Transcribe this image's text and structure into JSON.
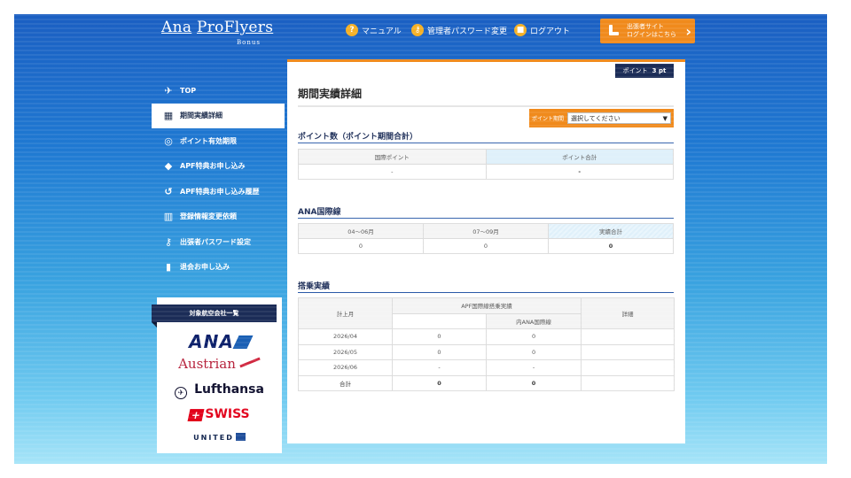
{
  "header": {
    "logo_main_a": "Ana",
    "logo_main_b": "ProFlyers",
    "logo_sub": "Bonus",
    "nav": [
      {
        "icon": "question-circle-icon",
        "glyph": "?",
        "label": "マニュアル"
      },
      {
        "icon": "key-circle-icon",
        "glyph": "⚷",
        "label": "管理者パスワード変更"
      },
      {
        "icon": "lock-circle-icon",
        "glyph": "■",
        "label": "ログアウト"
      }
    ],
    "sub_login": {
      "line1": "出張者サイト",
      "line2": "ログインはこちら",
      "chevron": "›"
    }
  },
  "menu": [
    {
      "icon": "airplane-icon",
      "glyph": "✈",
      "label": "TOP",
      "active": false
    },
    {
      "icon": "calendar-icon",
      "glyph": "▦",
      "label": "期間実績詳細",
      "active": true
    },
    {
      "icon": "coin-icon",
      "glyph": "◎",
      "label": "ポイント有効期限",
      "active": false
    },
    {
      "icon": "gift-icon",
      "glyph": "◆",
      "label": "APF特典お申し込み",
      "active": false
    },
    {
      "icon": "history-icon",
      "glyph": "↺",
      "label": "APF特典お申し込み履歴",
      "active": false
    },
    {
      "icon": "form-icon",
      "glyph": "▥",
      "label": "登録情報変更依頼",
      "active": false
    },
    {
      "icon": "key-person-icon",
      "glyph": "⚷",
      "label": "出張者パスワード設定",
      "active": false
    },
    {
      "icon": "exit-door-icon",
      "glyph": "▮",
      "label": "退会お申し込み",
      "active": false
    }
  ],
  "airlines": {
    "heading": "対象航空会社一覧",
    "list": [
      "ANA",
      "Austrian",
      "Lufthansa",
      "SWISS",
      "UNITED"
    ]
  },
  "main": {
    "points_badge": {
      "label": "ポイント",
      "value": "3 pt"
    },
    "title": "期間実績詳細",
    "filter": {
      "label": "ポイント期間",
      "selected": "選択してください"
    },
    "points_section": {
      "title": "ポイント数（ポイント期間合計）",
      "headers": [
        "国際ポイント",
        "ポイント合計"
      ],
      "values": [
        "-",
        "-"
      ]
    },
    "ana_section": {
      "title": "ANA国際線",
      "headers": [
        "04〜06月",
        "07〜09月",
        "実績合計"
      ],
      "values": [
        "0",
        "0",
        "0"
      ]
    },
    "boarding_section": {
      "title": "搭乗実績",
      "col_month": "計上月",
      "col_group": "APF国際線搭乗実績",
      "col_sub": "内ANA国際線",
      "col_detail": "詳細",
      "rows": [
        {
          "month": "2026/04",
          "apf": "0",
          "ana": "0",
          "detail": ""
        },
        {
          "month": "2026/05",
          "apf": "0",
          "ana": "0",
          "detail": ""
        },
        {
          "month": "2026/06",
          "apf": "-",
          "ana": "-",
          "detail": ""
        }
      ],
      "total": {
        "month": "合計",
        "apf": "0",
        "ana": "0",
        "detail": ""
      }
    }
  },
  "colors": {
    "accent": "#f08a1c",
    "navy": "#1b2c57",
    "bg_blue": "#1f79d2"
  }
}
